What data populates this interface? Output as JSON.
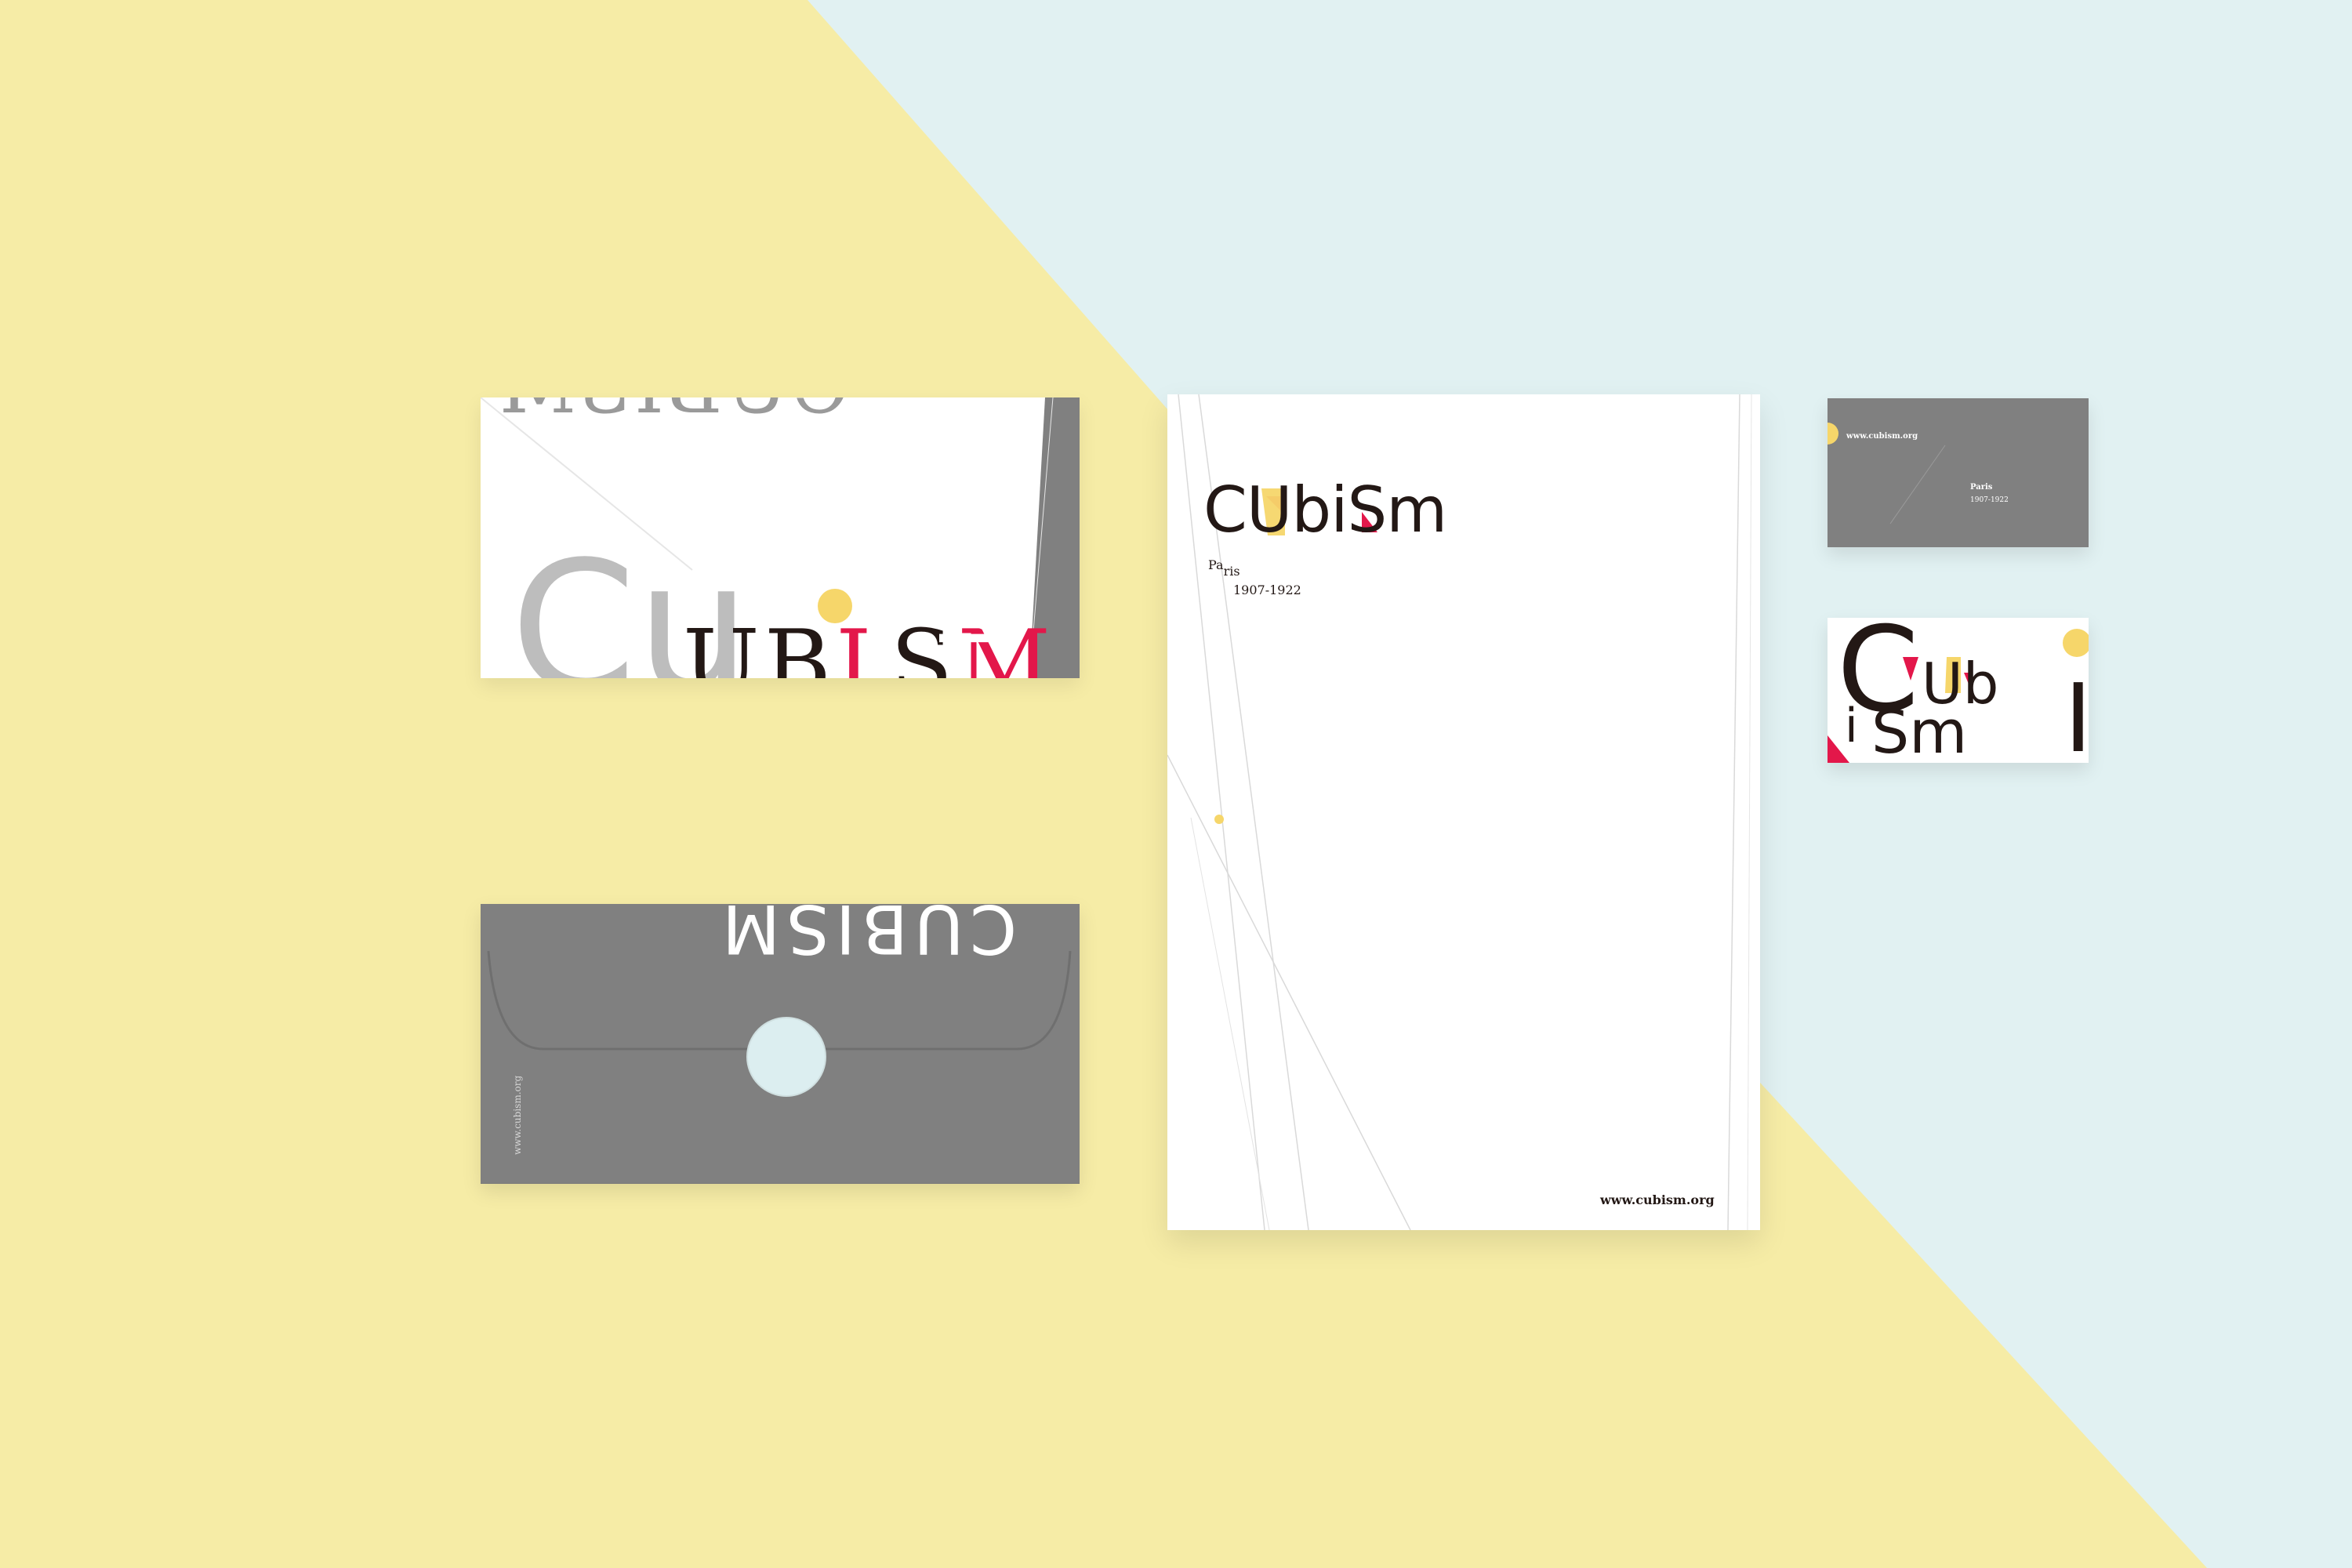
{
  "colors": {
    "background_yellow": "#F6ECA6",
    "background_blue": "#E1F1F2",
    "paper_white": "#FFFFFF",
    "paper_gray": "#808080",
    "ink_black": "#231815",
    "accent_red": "#E3174A",
    "accent_yellow": "#F6D66A",
    "seal_blue": "#DCEEF0"
  },
  "envelope_front": {
    "watermark_top": "CUBISM",
    "lettering_gray": "Cu",
    "lettering_black_1": "UB",
    "lettering_red": "I",
    "lettering_black_2": "S",
    "lettering_red_2": "M",
    "lettering_vertical": "M"
  },
  "envelope_back": {
    "flap_text": "CUBISM",
    "side_url": "www.cubism.org"
  },
  "letterhead": {
    "logo": [
      "C",
      "U",
      "b",
      "i",
      "S",
      "m"
    ],
    "place_1": "Pa",
    "place_2": "ris",
    "years": "1907-1922",
    "url": "www.cubism.org"
  },
  "card_back": {
    "url": "www.cubism.org",
    "place": "Paris",
    "years": "1907-1922"
  },
  "card_front": {
    "letters": [
      "C",
      "Ub",
      "i",
      "S",
      "m",
      "I"
    ]
  }
}
